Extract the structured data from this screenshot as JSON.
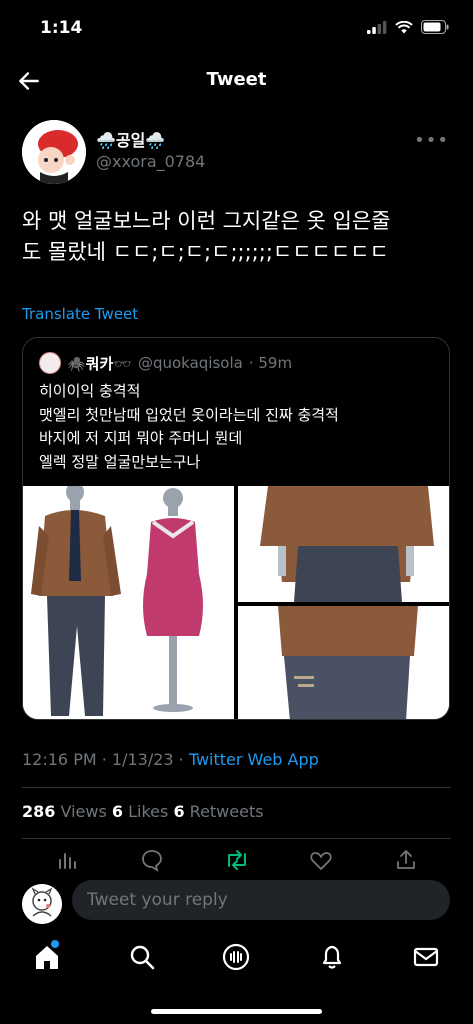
{
  "status": {
    "time": "1:14"
  },
  "header": {
    "title": "Tweet"
  },
  "tweet": {
    "display_name": "🌧️공일🌧️",
    "handle": "@xxora_0784",
    "text_line1": "와 맷 얼굴보느라 이런 그지같은 옷 입은줄",
    "text_line2": "도 몰랐네 ㄷㄷ;ㄷ;ㄷ;ㄷ;;;;;;ㄷㄷㄷㄷㄷㄷ",
    "translate": "Translate Tweet",
    "timestamp": "12:16 PM · 1/13/23 · ",
    "source": "Twitter Web App",
    "views_count": "286",
    "views_label": " Views  ",
    "likes_count": "6",
    "likes_label": " Likes  ",
    "retweets_count": "6",
    "retweets_label": " Retweets"
  },
  "quote": {
    "name": "🕷️쿼카🕶️",
    "handle": "@quokaqisola",
    "time": "· 59m",
    "lines": [
      "히이이익 충격적",
      "맷엘리 첫만남때 입었던 옷이라는데 진짜 충격적",
      "바지에 저 지퍼 뭐야 주머니 뭔데",
      "엘렉 정말 얼굴만보는구나"
    ]
  },
  "reply": {
    "placeholder": "Tweet your reply"
  },
  "icons": [
    "back-arrow-icon",
    "more-icon",
    "reply-icon",
    "retweet-icon",
    "like-icon",
    "share-icon",
    "home-icon",
    "search-icon",
    "spaces-icon",
    "notifications-icon",
    "messages-icon"
  ],
  "colors": {
    "accent": "#1d9bf0",
    "retweet": "#00ba7c",
    "muted": "#71767b",
    "border": "#2f3336"
  }
}
